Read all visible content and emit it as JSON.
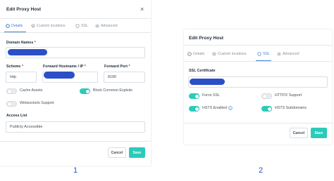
{
  "colors": {
    "accent": "#2bcbba",
    "tab_active": "#467fcf",
    "required": "#cd201f",
    "redaction": "#2b4fc6"
  },
  "panel1": {
    "title": "Edit Proxy Host",
    "close": "×",
    "tabs": [
      {
        "label": "Details",
        "icon": "target-icon",
        "active": true
      },
      {
        "label": "Custom locations",
        "icon": "layers-icon",
        "active": false
      },
      {
        "label": "SSL",
        "icon": "shield-icon",
        "active": false
      },
      {
        "label": "Advanced",
        "icon": "gear-icon",
        "active": false
      }
    ],
    "domain_names_label": "Domain Names",
    "scheme_label": "Scheme",
    "scheme_value": "http",
    "forward_host_label": "Forward Hostname / IP",
    "forward_port_label": "Forward Port",
    "forward_port_value": "8180",
    "required_mark": "*",
    "cache_assets": {
      "label": "Cache Assets",
      "on": false
    },
    "block_exploits": {
      "label": "Block Common Exploits",
      "on": true
    },
    "websockets": {
      "label": "Websockets Support",
      "on": false
    },
    "access_list_label": "Access List",
    "access_list_value": "Publicly Accessible",
    "cancel_label": "Cancel",
    "save_label": "Save",
    "caption": "1"
  },
  "panel2": {
    "title": "Edit Proxy Host",
    "tabs": [
      {
        "label": "Details",
        "icon": "target-icon",
        "active": false
      },
      {
        "label": "Custom locations",
        "icon": "layers-icon",
        "active": false
      },
      {
        "label": "SSL",
        "icon": "shield-icon",
        "active": true
      },
      {
        "label": "Advanced",
        "icon": "gear-icon",
        "active": false
      }
    ],
    "ssl_certificate_label": "SSL Certificate",
    "force_ssl": {
      "label": "Force SSL",
      "on": true
    },
    "http2": {
      "label": "HTTP/2 Support",
      "on": false
    },
    "hsts_enabled": {
      "label": "HSTS Enabled",
      "on": true,
      "info_icon": "info-icon"
    },
    "hsts_subdomains": {
      "label": "HSTS Subdomains",
      "on": true
    },
    "cancel_label": "Cancel",
    "save_label": "Save",
    "caption": "2"
  }
}
